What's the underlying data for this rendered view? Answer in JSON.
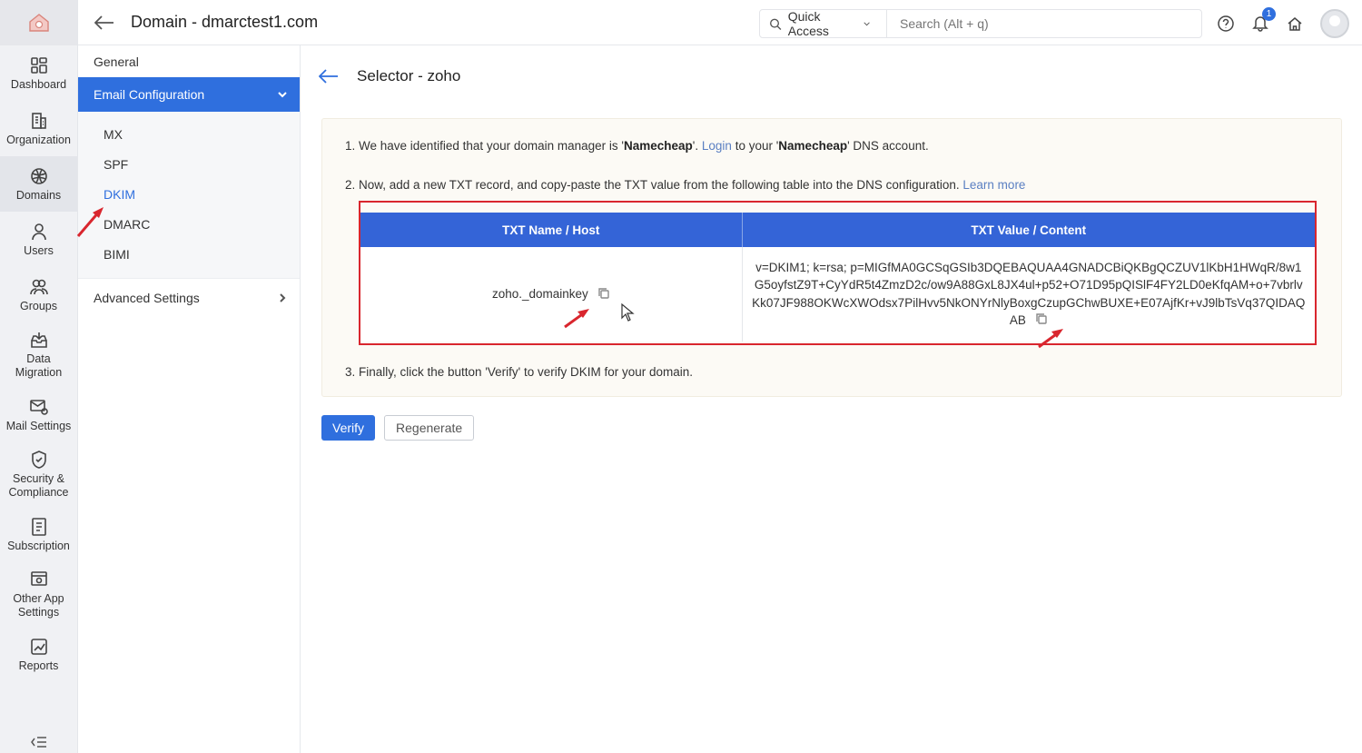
{
  "topbar": {
    "title": "Domain - dmarctest1.com",
    "quick_access": "Quick Access",
    "search_placeholder": "Search (Alt + q)",
    "notification_count": "1"
  },
  "rail": {
    "items": [
      {
        "label": "Dashboard"
      },
      {
        "label": "Organization"
      },
      {
        "label": "Domains"
      },
      {
        "label": "Users"
      },
      {
        "label": "Groups"
      },
      {
        "label": "Data Migration"
      },
      {
        "label": "Mail Settings"
      },
      {
        "label": "Security & Compliance"
      },
      {
        "label": "Subscription"
      },
      {
        "label": "Other App Settings"
      },
      {
        "label": "Reports"
      }
    ]
  },
  "subnav": {
    "general": "General",
    "active": "Email Configuration",
    "items": [
      "MX",
      "SPF",
      "DKIM",
      "DMARC",
      "BIMI"
    ],
    "advanced": "Advanced Settings"
  },
  "main": {
    "selector_title": "Selector - zoho",
    "step1": {
      "prefix": "1. We have identified that your domain manager is '",
      "manager": "Namecheap",
      "mid": "'. ",
      "login": "Login",
      "mid2": " to your '",
      "manager2": "Namecheap",
      "suffix": "' DNS account."
    },
    "step2": {
      "text": "2. Now, add a new TXT record, and copy-paste the TXT value from the following table into the DNS configuration.",
      "learn_more": "Learn more"
    },
    "table": {
      "col_name": "TXT Name / Host",
      "col_value": "TXT Value / Content",
      "host": "zoho._domainkey",
      "value": "v=DKIM1; k=rsa; p=MIGfMA0GCSqGSIb3DQEBAQUAA4GNADCBiQKBgQCZUV1lKbH1HWqR/8w1G5oyfstZ9T+CyYdR5t4ZmzD2c/ow9A88GxL8JX4ul+p52+O71D95pQISlF4FY2LD0eKfqAM+o+7vbrlvKk07JF988OKWcXWOdsx7PilHvv5NkONYrNlyBoxgCzupGChwBUXE+E07AjfKr+vJ9lbTsVq37QIDAQAB"
    },
    "step3": "3. Finally, click the button 'Verify' to verify DKIM for your domain.",
    "verify_label": "Verify",
    "regenerate_label": "Regenerate"
  },
  "colors": {
    "accent": "#2f6fde",
    "table_header": "#3464d7",
    "annotation": "#d9262e"
  }
}
